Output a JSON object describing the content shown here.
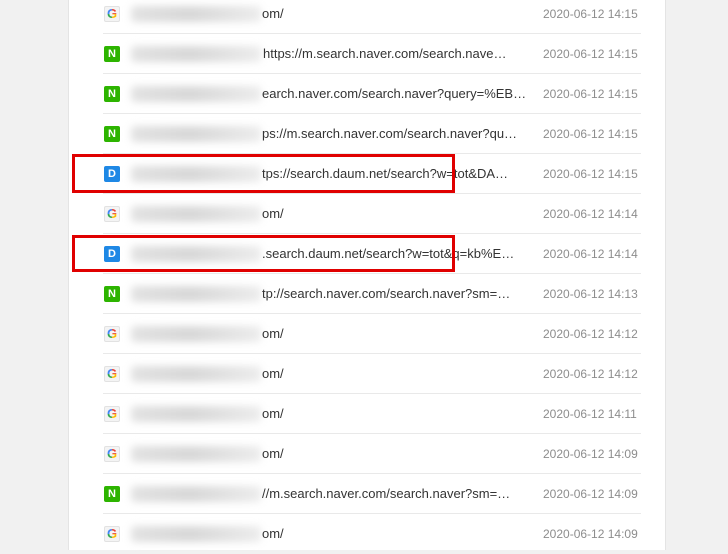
{
  "history": {
    "rows": [
      {
        "favicon": "google-favicon-icon",
        "url_text": "om/",
        "time": "2020-06-12 14:15"
      },
      {
        "favicon": "naver-favicon-icon",
        "url_text": "https://m.search.naver.com/search.nave…",
        "time": "2020-06-12 14:15"
      },
      {
        "favicon": "naver-favicon-icon",
        "url_text": "earch.naver.com/search.naver?query=%EB…",
        "time": "2020-06-12 14:15"
      },
      {
        "favicon": "naver-favicon-icon",
        "url_text": "ps://m.search.naver.com/search.naver?qu…",
        "time": "2020-06-12 14:15"
      },
      {
        "favicon": "daum-favicon-icon",
        "url_text": "tps://search.daum.net/search?w=tot&DA…",
        "time": "2020-06-12 14:15",
        "highlighted": true
      },
      {
        "favicon": "google-favicon-icon",
        "url_text": "om/",
        "time": "2020-06-12 14:14"
      },
      {
        "favicon": "daum-favicon-icon",
        "url_text": ".search.daum.net/search?w=tot&q=kb%E…",
        "time": "2020-06-12 14:14",
        "highlighted": true
      },
      {
        "favicon": "naver-favicon-icon",
        "url_text": "tp://search.naver.com/search.naver?sm=…",
        "time": "2020-06-12 14:13"
      },
      {
        "favicon": "google-favicon-icon",
        "url_text": "om/",
        "time": "2020-06-12 14:12"
      },
      {
        "favicon": "google-favicon-icon",
        "url_text": "om/",
        "time": "2020-06-12 14:12"
      },
      {
        "favicon": "google-favicon-icon",
        "url_text": "om/",
        "time": "2020-06-12 14:11"
      },
      {
        "favicon": "google-favicon-icon",
        "url_text": "om/",
        "time": "2020-06-12 14:09"
      },
      {
        "favicon": "naver-favicon-icon",
        "url_text": "//m.search.naver.com/search.naver?sm=…",
        "time": "2020-06-12 14:09"
      },
      {
        "favicon": "google-favicon-icon",
        "url_text": "om/",
        "time": "2020-06-12 14:09"
      }
    ],
    "favicon_letters": {
      "google": "G",
      "naver": "N",
      "daum": "D"
    }
  },
  "colors": {
    "highlight_box": "#e00000",
    "naver": "#2db400",
    "daum": "#1e88e5"
  }
}
